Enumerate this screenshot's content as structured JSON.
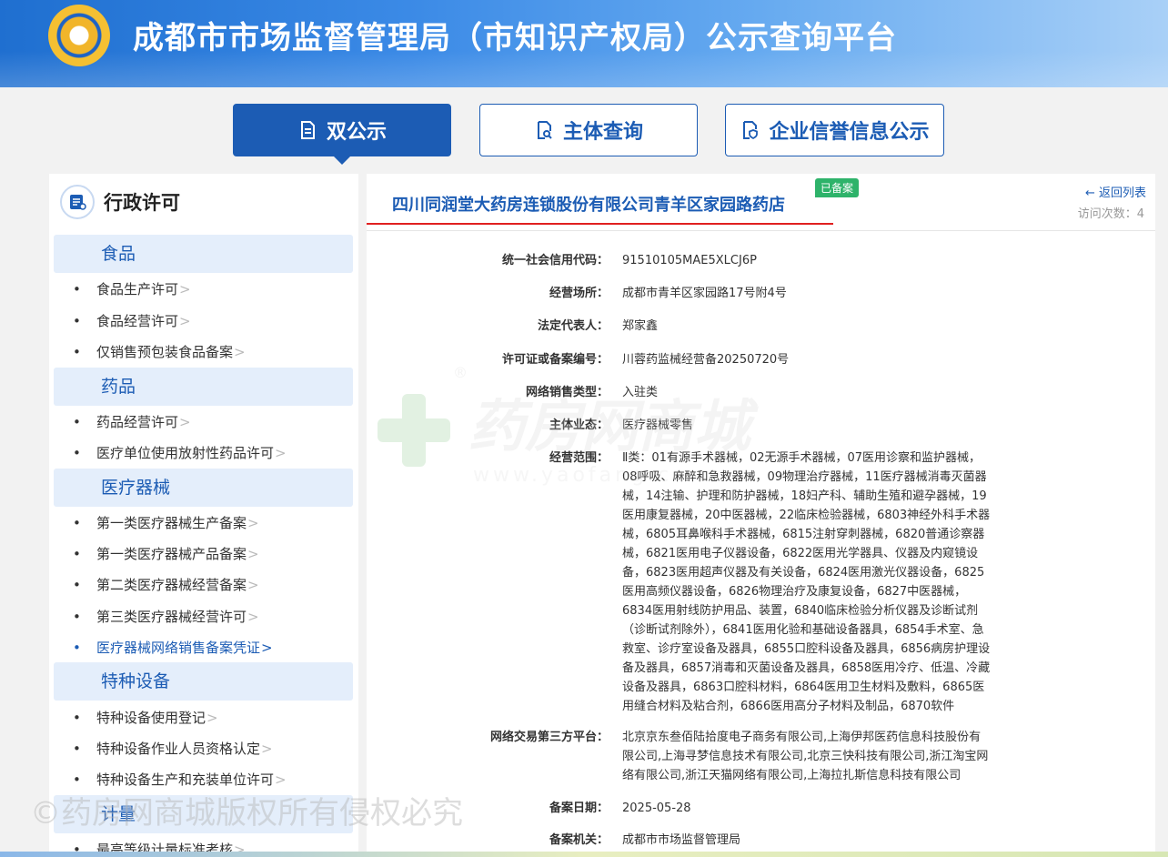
{
  "header": {
    "title": "成都市市场监督管理局（市知识产权局）公示查询平台"
  },
  "tabs": [
    {
      "label": "双公示",
      "icon": "document-icon",
      "active": true
    },
    {
      "label": "主体查询",
      "icon": "search-document-icon",
      "active": false
    },
    {
      "label": "企业信誉信息公示",
      "icon": "shield-document-icon",
      "active": false
    }
  ],
  "sidebar": {
    "title": "行政许可",
    "categories": [
      {
        "label": "食品",
        "items": [
          "食品生产许可",
          "食品经营许可",
          "仅销售预包装食品备案"
        ]
      },
      {
        "label": "药品",
        "items": [
          "药品经营许可",
          "医疗单位使用放射性药品许可"
        ]
      },
      {
        "label": "医疗器械",
        "items": [
          "第一类医疗器械生产备案",
          "第一类医疗器械产品备案",
          "第二类医疗器械经营备案",
          "第三类医疗器械经营许可",
          "医疗器械网络销售备案凭证"
        ]
      },
      {
        "label": "特种设备",
        "items": [
          "特种设备使用登记",
          "特种设备作业人员资格认定",
          "特种设备生产和充装单位许可"
        ]
      },
      {
        "label": "计量",
        "items": [
          "最高等级计量标准考核"
        ]
      }
    ],
    "arrow": ">"
  },
  "detail": {
    "company": "四川同润堂大药房连锁股份有限公司青羊区家园路药店",
    "badge": "已备案",
    "back_label": "← 返回列表",
    "visits": "访问次数：4",
    "fields": [
      {
        "label": "统一社会信用代码：",
        "value": "91510105MAE5XLCJ6P"
      },
      {
        "label": "经营场所：",
        "value": "成都市青羊区家园路17号附4号"
      },
      {
        "label": "法定代表人：",
        "value": "郑家鑫"
      },
      {
        "label": "许可证或备案编号：",
        "value": "川蓉药监械经营备20250720号"
      },
      {
        "label": "网络销售类型：",
        "value": "入驻类"
      },
      {
        "label": "主体业态：",
        "value": "医疗器械零售"
      },
      {
        "label": "经营范围：",
        "value": "Ⅱ类：01有源手术器械，02无源手术器械，07医用诊察和监护器械，08呼吸、麻醉和急救器械，09物理治疗器械，11医疗器械消毒灭菌器械，14注输、护理和防护器械，18妇产科、辅助生殖和避孕器械，19医用康复器械，20中医器械，22临床检验器械，6803神经外科手术器械，6805耳鼻喉科手术器械，6815注射穿刺器械，6820普通诊察器械，6821医用电子仪器设备，6822医用光学器具、仪器及内窥镜设备，6823医用超声仪器及有关设备，6824医用激光仪器设备，6825医用高频仪器设备，6826物理治疗及康复设备，6827中医器械，6834医用射线防护用品、装置，6840临床检验分析仪器及诊断试剂（诊断试剂除外），6841医用化验和基础设备器具，6854手术室、急救室、诊疗室设备及器具，6855口腔科设备及器具，6856病房护理设备及器具，6857消毒和灭菌设备及器具，6858医用冷疗、低温、冷藏设备及器具，6863口腔科材料，6864医用卫生材料及敷料，6865医用缝合材料及粘合剂，6866医用高分子材料及制品，6870软件"
      },
      {
        "label": "网络交易第三方平台：",
        "value": "北京京东叁佰陆拾度电子商务有限公司,上海伊邦医药信息科技股份有限公司,上海寻梦信息技术有限公司,北京三快科技有限公司,浙江淘宝网络有限公司,浙江天猫网络有限公司,上海拉扎斯信息科技有限公司"
      },
      {
        "label": "备案日期：",
        "value": "2025-05-28"
      },
      {
        "label": "备案机关：",
        "value": "成都市市场监督管理局"
      }
    ]
  },
  "watermarks": {
    "center_text": "药房网商城",
    "center_url": "www.yaofang.cn",
    "center_mark": "®",
    "bottom_text": "©药房网商城版权所有侵权必究"
  },
  "colors": {
    "primary": "#1c5cb4",
    "badge": "#2eb36a",
    "accent_line": "#e02020"
  }
}
